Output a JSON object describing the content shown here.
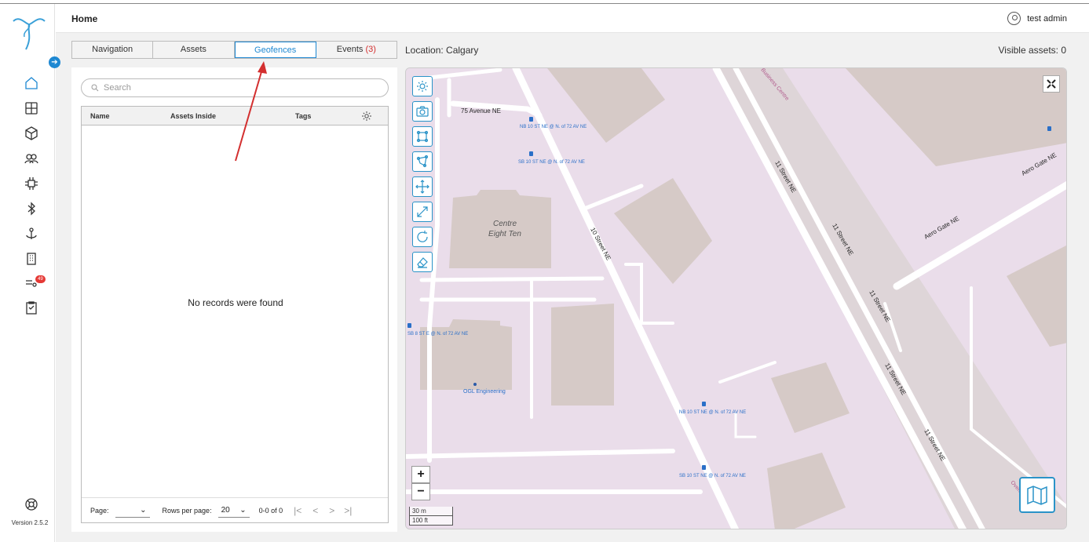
{
  "app": {
    "version": "Version 2.5.2",
    "badge_count": "49"
  },
  "header": {
    "title": "Home",
    "user": "test admin"
  },
  "tabs": [
    {
      "label": "Navigation"
    },
    {
      "label": "Assets"
    },
    {
      "label": "Geofences"
    },
    {
      "label": "Events",
      "count": "(3)"
    }
  ],
  "location": "Location: Calgary",
  "visible_assets": "Visible assets: 0",
  "search": {
    "placeholder": "Search"
  },
  "table": {
    "columns": [
      "Name",
      "Assets Inside",
      "Tags"
    ],
    "empty_message": "No records were found"
  },
  "pager": {
    "page_label": "Page:",
    "page_value": "",
    "rows_label": "Rows per page:",
    "rows_value": "20",
    "range": "0-0 of 0"
  },
  "map": {
    "labels": {
      "street_75": "75 Avenue NE",
      "centre": "Centre",
      "eight_ten": "Eight Ten",
      "tenth_street": "10 Street NE",
      "eleventh_1": "11 Street NE",
      "eleventh_2": "11 Street NE",
      "eleventh_3": "11 Street NE",
      "eleventh_4": "11 Street NE",
      "eleventh_5": "11 Street NE",
      "aero_1": "Aero Gate NE",
      "aero_2": "Aero Gate NE",
      "ogl": "OGL Engineering",
      "business_centre": "Business Centre",
      "overlook": "Overlook",
      "stop_nb_top": "NB 10 ST NE @ N. of 72 AV NE",
      "stop_sb_top": "SB 10 ST NE @ N. of 72 AV NE",
      "stop_nb_bottom": "NB 10 ST NE @ N. of 72 AV NE",
      "stop_sb_bottom": "SB 10 ST NE @ N. of 72 AV NE",
      "stop_sb8": "SB 8 ST E @ N. of 72 AV NE"
    },
    "scale_m": "30 m",
    "scale_ft": "100 ft",
    "zoom_in": "+",
    "zoom_out": "−",
    "tools": [
      "settings-tool-icon",
      "camera-icon",
      "rectangle-draw-icon",
      "polygon-draw-icon",
      "move-icon",
      "resize-icon",
      "rotate-icon",
      "eraser-icon"
    ]
  },
  "colors": {
    "accent": "#1e88d2",
    "map_bg": "#eaddea",
    "building": "#d6cac7",
    "road": "#ffffff",
    "arrow": "#d32f2f"
  }
}
